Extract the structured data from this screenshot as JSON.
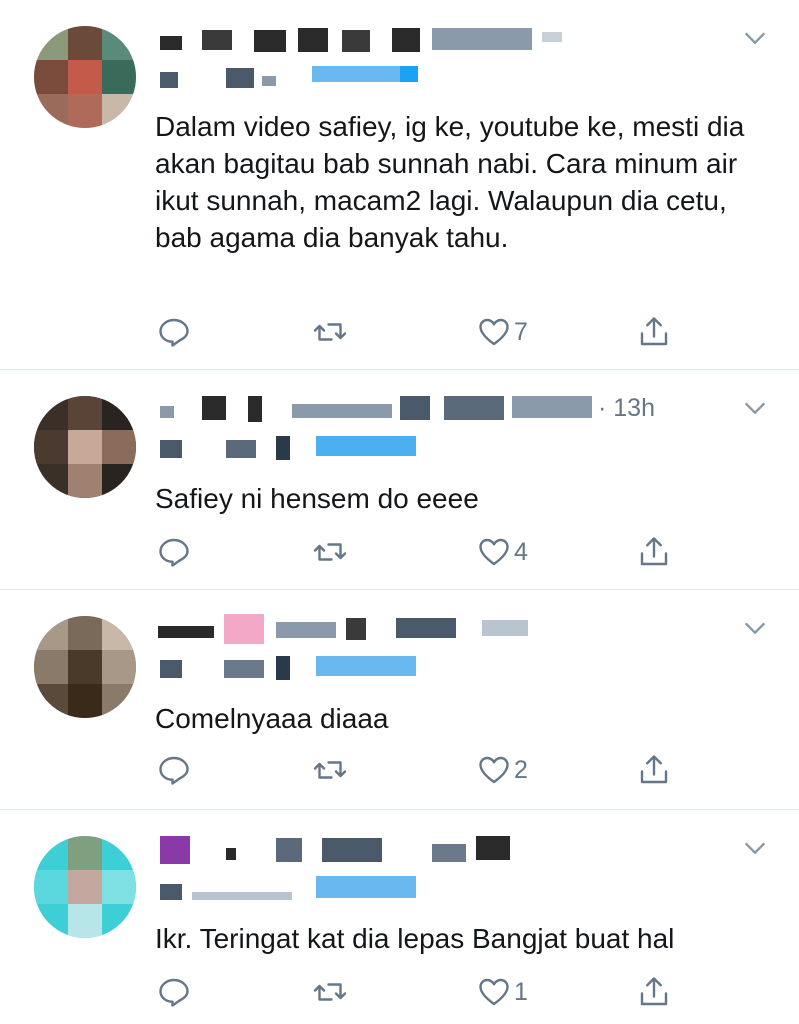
{
  "tweets": [
    {
      "time": "",
      "text": "Dalam video safiey, ig ke, youtube ke, mesti dia akan bagitau bab sunnah nabi. Cara minum air ikut sunnah, macam2 lagi. Walaupun dia cetu, bab agama dia banyak tahu.",
      "likes": "7",
      "avatar_colors": [
        "#6b4a3a",
        "#9a7a6b",
        "#c45a4a",
        "#3a6b5a",
        "#7a5a4a",
        "#b9a89a"
      ]
    },
    {
      "time": "· 13h",
      "text": "Safiey ni hensem do eeee",
      "likes": "4",
      "avatar_colors": [
        "#2a2420",
        "#5a4438",
        "#8a6a5a",
        "#c8a898",
        "#3a3028",
        "#a08070"
      ]
    },
    {
      "time": "",
      "text": "Comelnyaaa diaaa",
      "likes": "2",
      "avatar_colors": [
        "#7a6a5a",
        "#a89888",
        "#4a3a2a",
        "#c8b8a8",
        "#5a4a3a",
        "#8a7a6a"
      ]
    },
    {
      "time": "",
      "text": "Ikr. Teringat kat dia lepas Bangjat buat hal",
      "likes": "1",
      "avatar_colors": [
        "#3ecfd6",
        "#7fe0e4",
        "#8a9a8a",
        "#c4a8a0",
        "#b8e6e8",
        "#5a8a7a"
      ]
    }
  ],
  "colors": {
    "text": "#14171a",
    "secondary": "#657786",
    "divider": "#e1e8ed",
    "mention": "#1da1f2"
  },
  "icons": [
    "reply-icon",
    "retweet-icon",
    "like-icon",
    "share-icon",
    "chevron-down-icon"
  ]
}
